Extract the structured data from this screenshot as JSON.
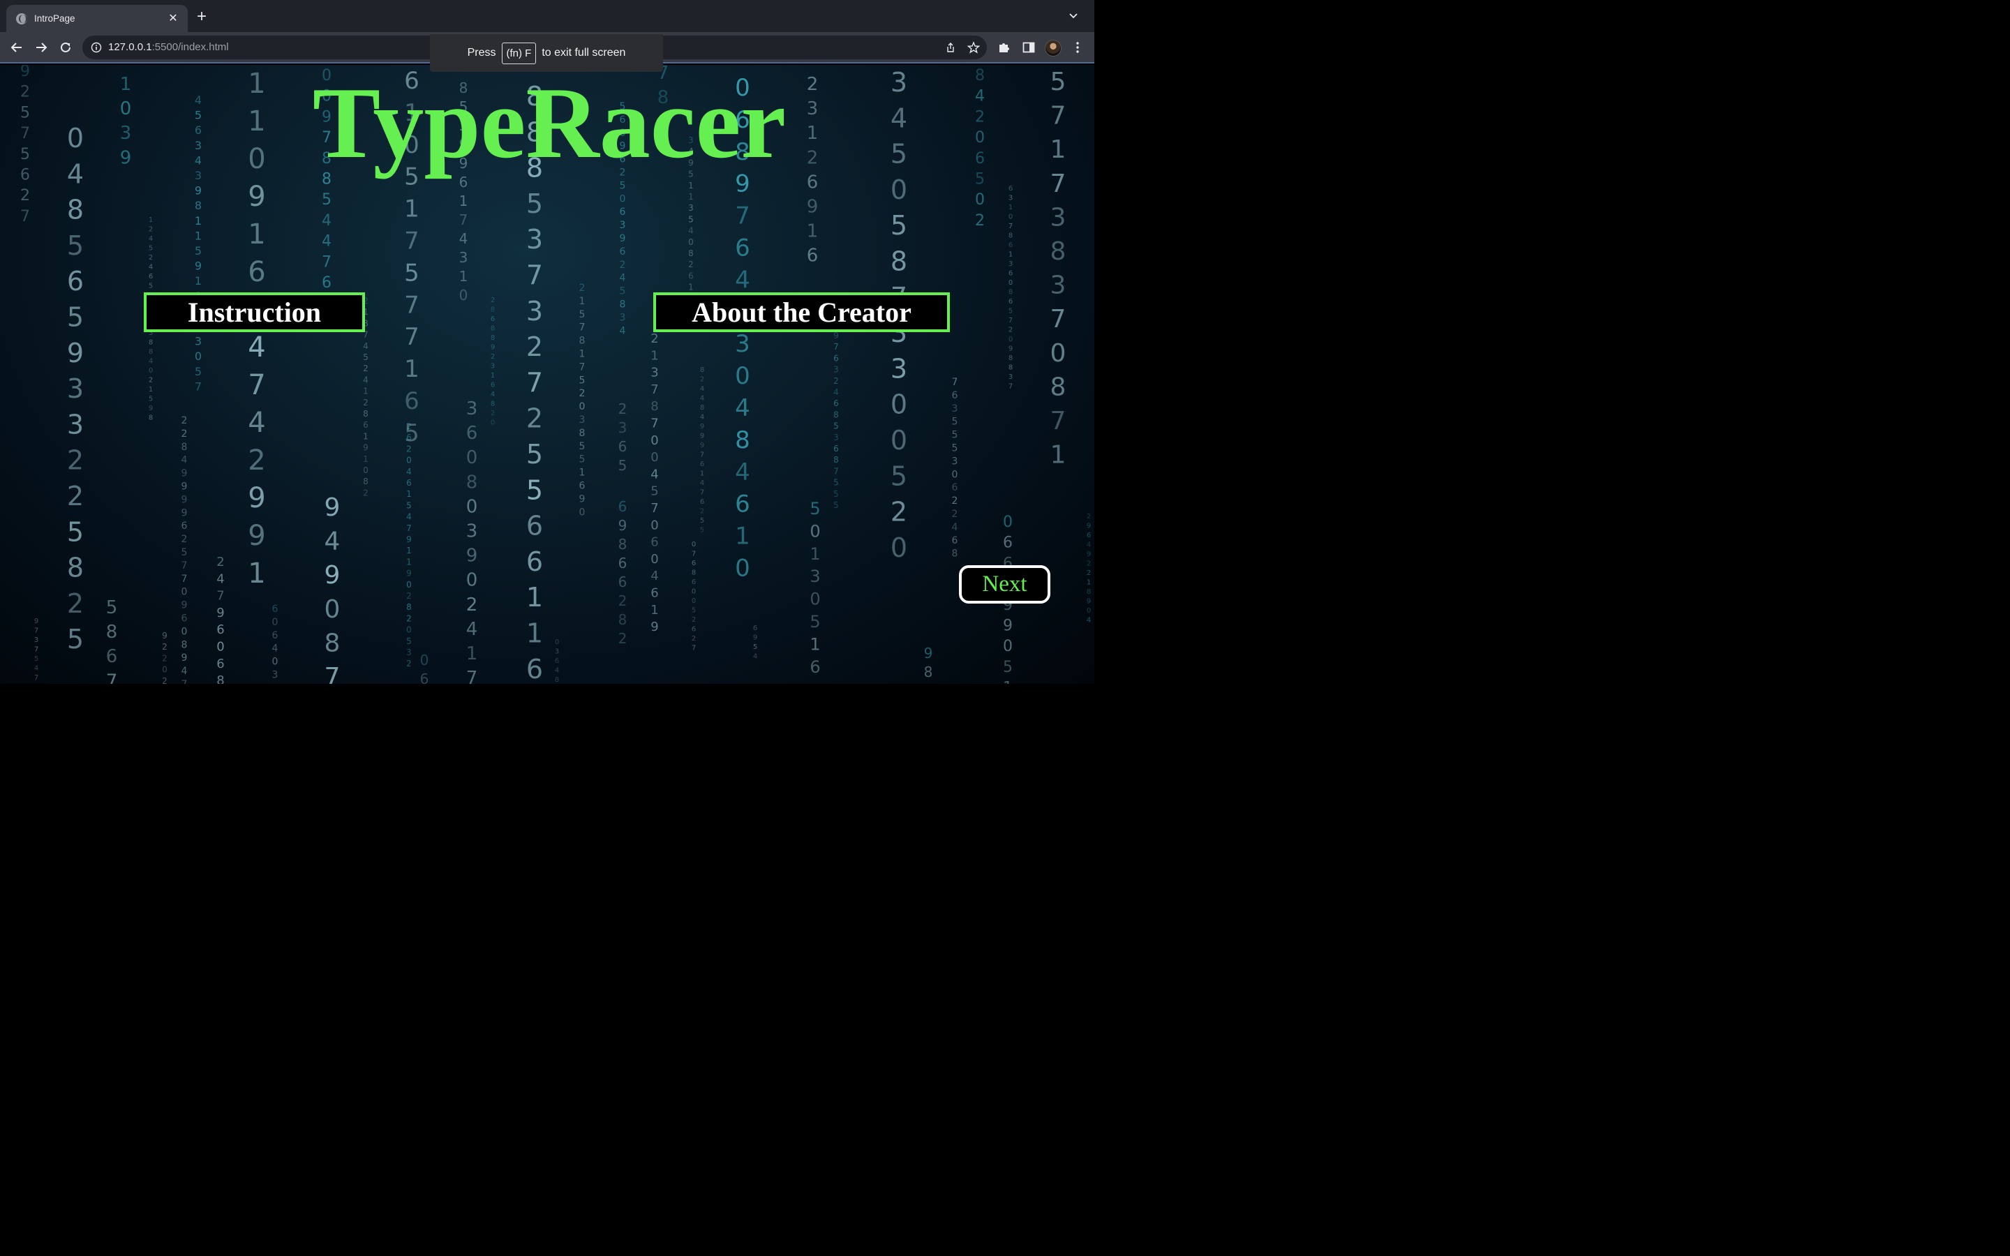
{
  "browser": {
    "tab_title": "IntroPage",
    "url_host": "127.0.0.1",
    "url_rest": ":5500/index.html",
    "fullscreen_toast": {
      "prefix": "Press",
      "key": "(fn) F",
      "suffix": "to exit full screen"
    }
  },
  "page": {
    "title": "TypeRacer",
    "instruction_label": "Instruction",
    "about_label": "About the Creator",
    "next_label": "Next"
  },
  "colors": {
    "accent_green": "#66ef51",
    "rain_digit": "#9cc4cf",
    "rain_cyan": "#46c6d8"
  }
}
